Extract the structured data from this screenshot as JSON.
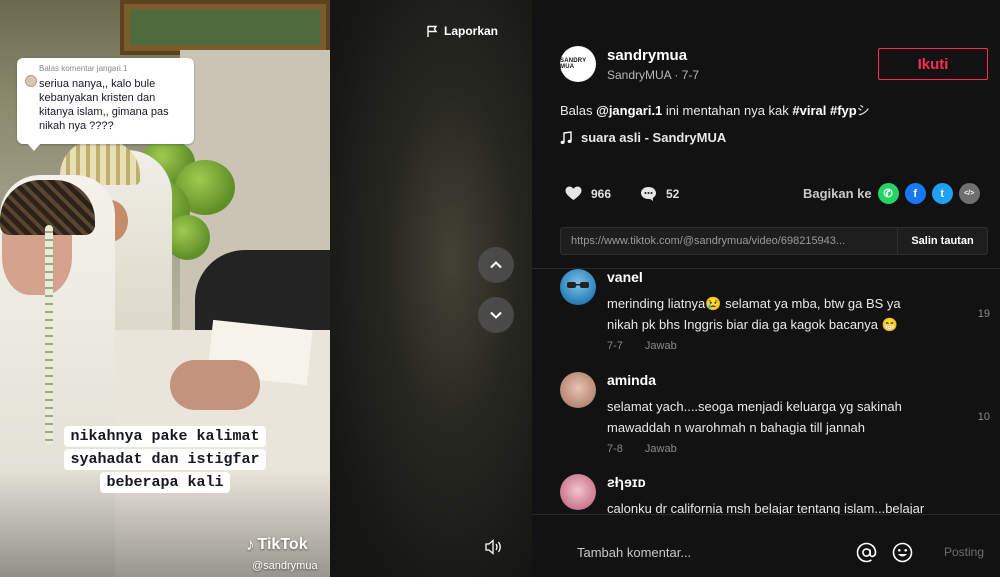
{
  "video": {
    "reply": {
      "header": "Balas komentar jangari.1",
      "text": "seriua nanya,, kalo bule kebanyakan kristen dan kitanya islam,, gimana pas nikah nya ????"
    },
    "caption_lines": [
      "nikahnya pake kalimat",
      "syahadat dan istigfar",
      "beberapa kali"
    ],
    "watermark": {
      "brand": "TikTok",
      "handle": "@sandrymua"
    }
  },
  "overlay": {
    "report_label": "Laporkan",
    "up_icon": "chevron-up-icon",
    "down_icon": "chevron-down-icon",
    "volume_icon": "volume-icon"
  },
  "author": {
    "avatar_text": "SANDRY MUA",
    "username": "sandrymua",
    "subtitle": "SandryMUA · 7-7",
    "follow_label": "Ikuti"
  },
  "description": {
    "prefix": "Balas ",
    "mention": "@jangari.1",
    "middle": " ini mentahan nya kak ",
    "tag1": "#viral",
    "space": " ",
    "tag2": "#fyp",
    "suffix": "シ"
  },
  "music": {
    "label": "suara asli - SandryMUA",
    "icon": "music-note-icon"
  },
  "stats": {
    "likes": "966",
    "comments": "52"
  },
  "share": {
    "label": "Bagikan ke",
    "targets": [
      {
        "name": "whatsapp",
        "color": "#25d366",
        "glyph": "✆"
      },
      {
        "name": "facebook",
        "color": "#1877f2",
        "glyph": "f"
      },
      {
        "name": "twitter",
        "color": "#1da1f2",
        "glyph": "t"
      },
      {
        "name": "embed",
        "color": "#6f6f6f",
        "glyph": "</>"
      }
    ]
  },
  "link": {
    "url": "https://www.tiktok.com/@sandrymua/video/698215943...",
    "copy_label": "Salin tautan"
  },
  "comments": [
    {
      "name": "vanel",
      "text": "merinding liatnya😢 selamat ya mba, btw ga BS ya nikah pk bhs Inggris biar dia ga kagok bacanya 😁",
      "date": "7-7",
      "reply_label": "Jawab",
      "likes": "19",
      "avatar_color": "#2a7fb8"
    },
    {
      "name": "aminda",
      "text": "selamat yach....seoga menjadi keluarga yg sakinah mawaddah n warohmah n bahagia till jannah",
      "date": "7-8",
      "reply_label": "Jawab",
      "likes": "10",
      "avatar_color": "#c9a08c"
    },
    {
      "name": "ƨƚɿɘɪᴅ",
      "text": "calonku dr california msh belajar tentang islam...belajar",
      "date": "",
      "reply_label": "",
      "likes": "",
      "avatar_color": "#d88fa3"
    }
  ],
  "composer": {
    "placeholder": "Tambah komentar...",
    "mention_icon": "at-icon",
    "emoji_icon": "emoji-icon",
    "post_label": "Posting"
  },
  "colors": {
    "accent": "#fe2c55",
    "background": "#121212"
  }
}
